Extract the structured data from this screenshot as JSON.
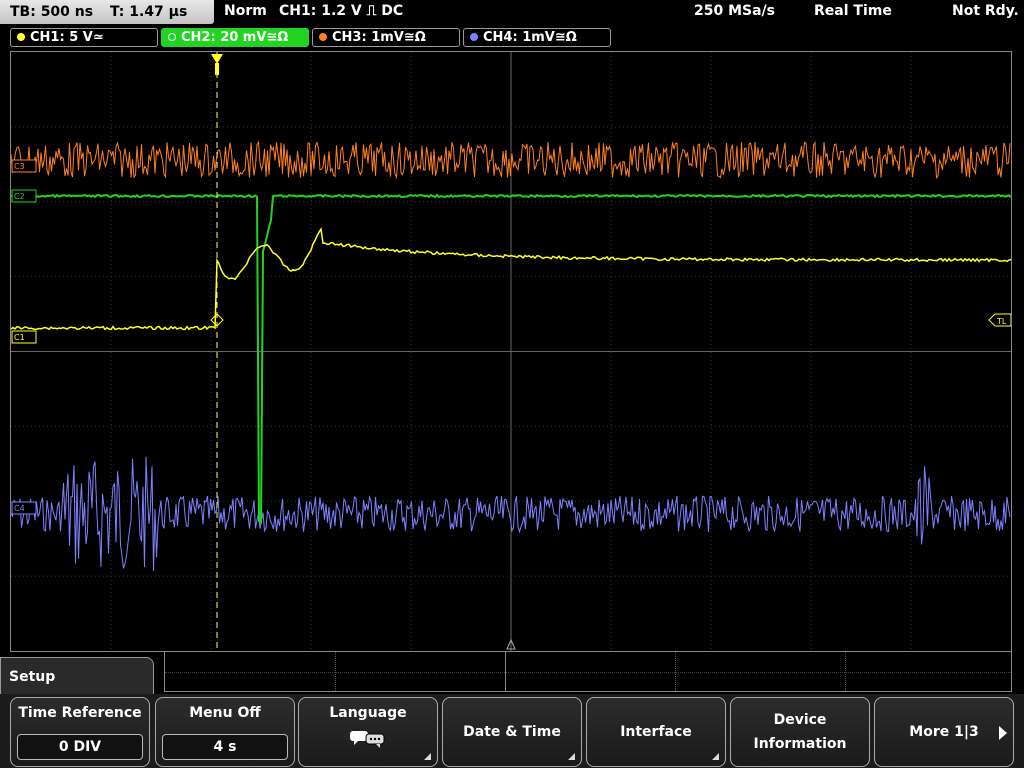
{
  "status": {
    "timebase": "TB: 500 ns",
    "trigger_pos": "T: 1.47 µs",
    "mode": "Norm",
    "trigger": "CH1: 1.2 V ⎍ DC",
    "sample_rate": "250 MSa/s",
    "acq": "Real Time",
    "ready": "Not Rdy."
  },
  "channels": [
    {
      "label": "CH1: 5 V≃",
      "color": "#ffff20"
    },
    {
      "label": "CH2: 20 mV≅Ω",
      "color": "#22d422"
    },
    {
      "label": "CH3: 1mV≅Ω",
      "color": "#ff8020"
    },
    {
      "label": "CH4: 1mV≅Ω",
      "color": "#8080ff"
    }
  ],
  "markers": {
    "c1": "C1",
    "c2": "C2",
    "c3": "C3",
    "c4": "C4",
    "tl": "TL"
  },
  "menu": {
    "title": "Setup",
    "keys": [
      {
        "label": "Time Reference",
        "value": "0 DIV"
      },
      {
        "label": "Menu Off",
        "value": "4 s"
      },
      {
        "label": "Language"
      },
      {
        "label": "Date & Time"
      },
      {
        "label": "Interface"
      },
      {
        "label": "Device",
        "label2": "Information"
      },
      {
        "label": "More 1|3"
      }
    ]
  }
}
